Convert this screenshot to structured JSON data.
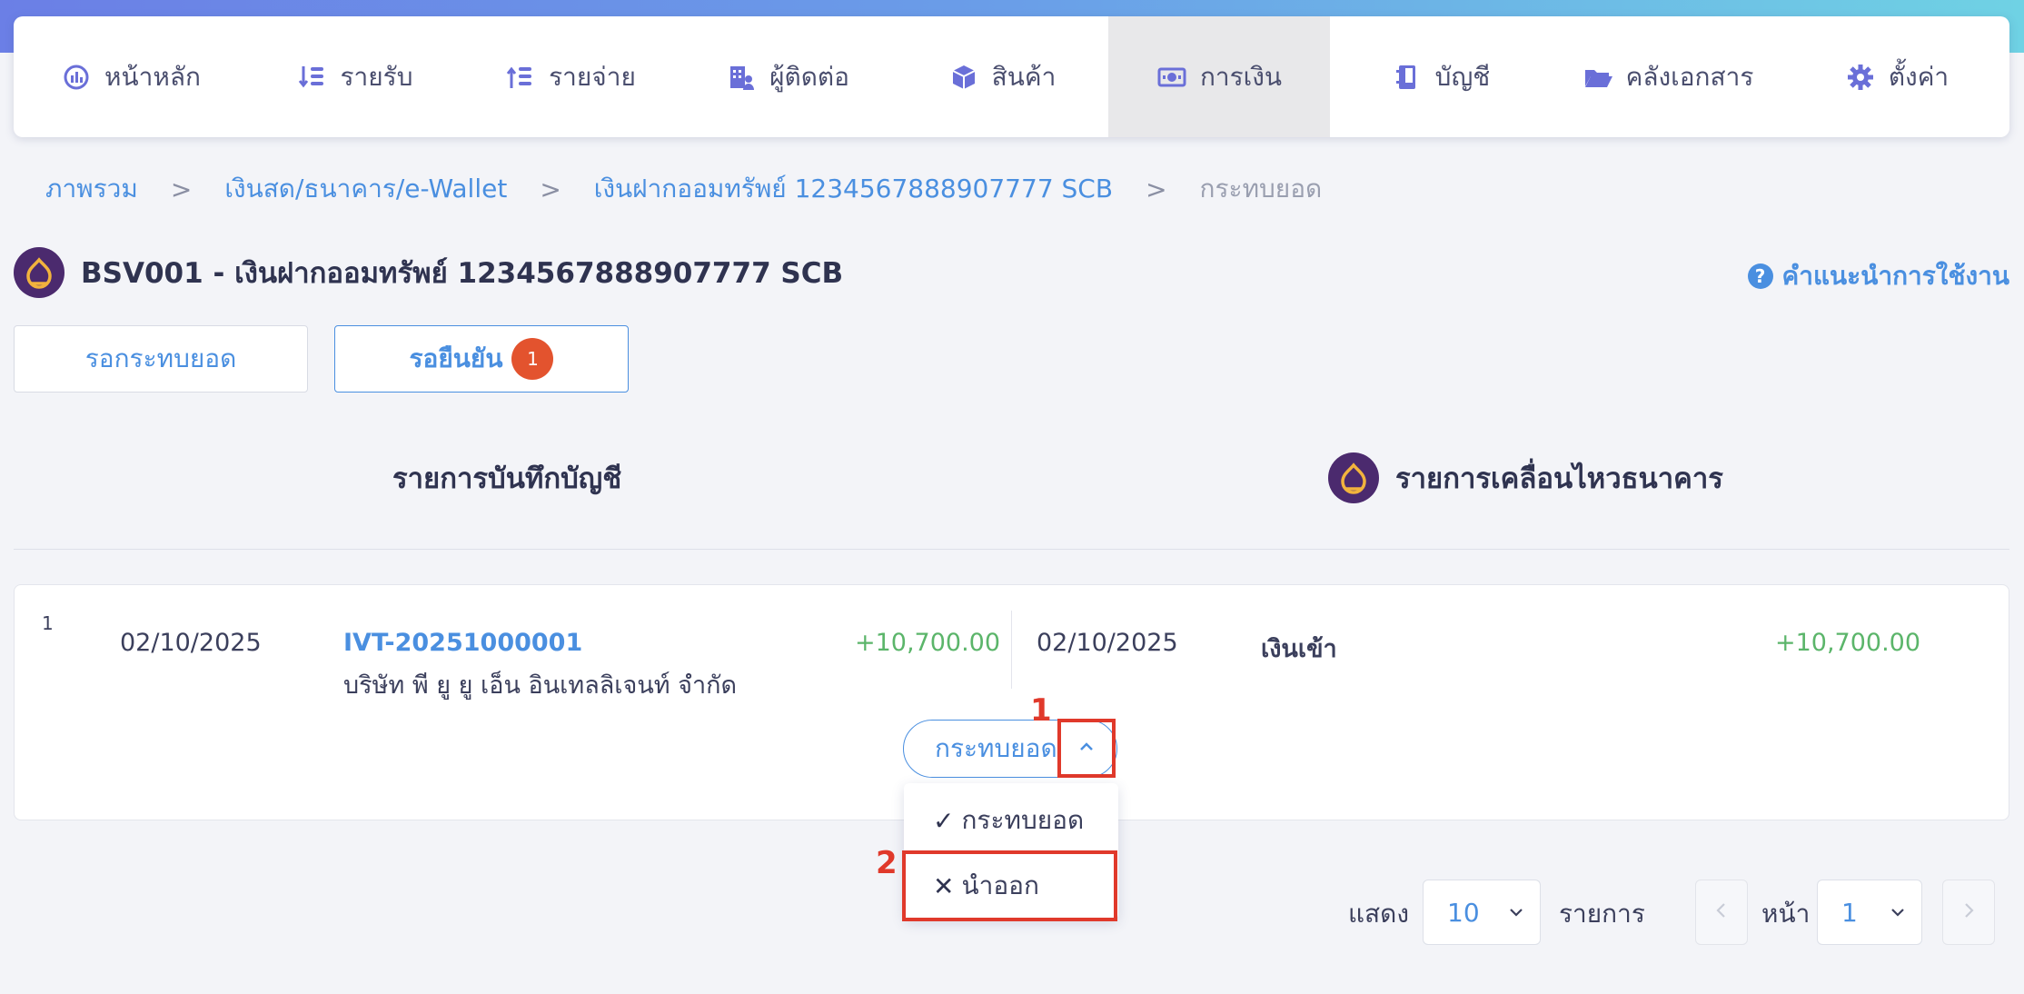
{
  "nav": {
    "items": [
      {
        "label": "หน้าหลัก",
        "icon": "dashboard-icon"
      },
      {
        "label": "รายรับ",
        "icon": "income-icon"
      },
      {
        "label": "รายจ่าย",
        "icon": "expense-icon"
      },
      {
        "label": "ผู้ติดต่อ",
        "icon": "contacts-icon"
      },
      {
        "label": "สินค้า",
        "icon": "product-box-icon"
      },
      {
        "label": "การเงิน",
        "icon": "money-icon",
        "active": true
      },
      {
        "label": "บัญชี",
        "icon": "ledger-icon"
      },
      {
        "label": "คลังเอกสาร",
        "icon": "folder-icon"
      },
      {
        "label": "ตั้งค่า",
        "icon": "gear-icon"
      }
    ]
  },
  "breadcrumb": {
    "items": [
      "ภาพรวม",
      "เงินสด/ธนาคาร/e-Wallet",
      "เงินฝากออมทรัพย์ 1234567888907777 SCB"
    ],
    "current": "กระทบยอด",
    "separator": ">"
  },
  "header": {
    "title": "BSV001 - เงินฝากออมทรัพย์ 1234567888907777 SCB",
    "help_label": "คำแนะนำการใช้งาน"
  },
  "tabs": {
    "pending_label": "รอกระทบยอด",
    "confirm_label": "รอยืนยัน",
    "confirm_count": "1"
  },
  "columns": {
    "left_title": "รายการบันทึกบัญชี",
    "right_title": "รายการเคลื่อนไหวธนาคาร"
  },
  "row": {
    "no": "1",
    "book_date": "02/10/2025",
    "doc_no": "IVT-20251000001",
    "party": "บริษัท พี ยู ยู เอ็น อินเทลลิเจนท์ จำกัด",
    "book_amount": "+10,700.00",
    "bank_date": "02/10/2025",
    "bank_desc": "เงินเข้า",
    "bank_amount": "+10,700.00"
  },
  "action": {
    "button_label": "กระทบยอด",
    "menu": [
      {
        "label": "กระทบยอด",
        "glyph": "✓"
      },
      {
        "label": "นำออก",
        "glyph": "✕"
      }
    ]
  },
  "annotations": {
    "marker1": "1",
    "marker2": "2",
    "color": "#e0392b"
  },
  "pagination": {
    "show_label": "แสดง",
    "page_size": "10",
    "items_label": "รายการ",
    "page_label": "หน้า",
    "page_value": "1"
  },
  "colors": {
    "accent": "#4a8fe0",
    "positive": "#5bb56a",
    "badge": "#e3532e",
    "bank_brand": "#4b2a6e"
  }
}
